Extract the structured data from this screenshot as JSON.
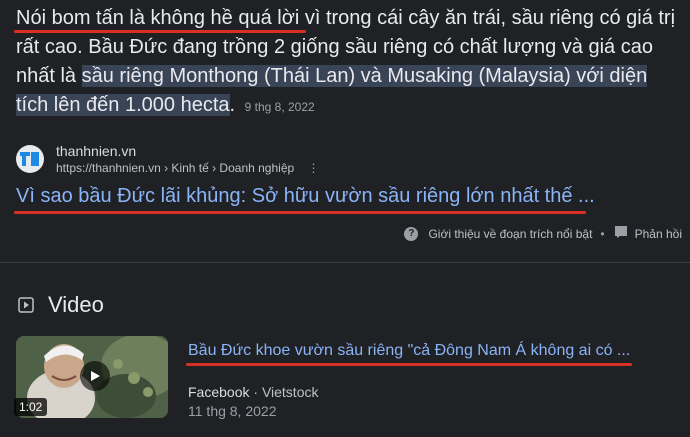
{
  "snippet": {
    "lead": "Nói bom tấn là không hề quá lời",
    "body": " vì trong cái cây ăn trái, sầu riêng có giá trị rất cao. Bầu Đức đang trồng 2 giống sầu riêng có chất lượng và giá cao nhất là ",
    "highlight": "sầu riêng Monthong (Thái Lan) và Musaking (Malaysia) với diện tích lên đến 1.000 hecta",
    "end": ".",
    "date": "9 thg 8, 2022"
  },
  "source": {
    "site": "thanhnien.vn",
    "breadcrumb": "https://thanhnien.vn › Kinh tế › Doanh nghiệp",
    "more_icon": "more-vert-icon"
  },
  "result": {
    "title": "Vì sao bầu Đức lãi khủng: Sở hữu vườn sầu riêng lớn nhất thế ..."
  },
  "about": {
    "label": "Giới thiệu về đoạn trích nổi bật",
    "separator": "•",
    "feedback": "Phản hồi"
  },
  "video_section": {
    "heading": "Video",
    "item": {
      "title": "Bầu Đức khoe vườn sầu riêng \"cả Đông Nam Á không ai có ...",
      "publisher": "Facebook",
      "dot": " · ",
      "channel": "Vietstock",
      "date": "11 thg 8, 2022",
      "duration": "1:02"
    }
  },
  "colors": {
    "background": "#202124",
    "link": "#8ab4f8",
    "highlight": "#394457",
    "annotation": "#d93025"
  }
}
